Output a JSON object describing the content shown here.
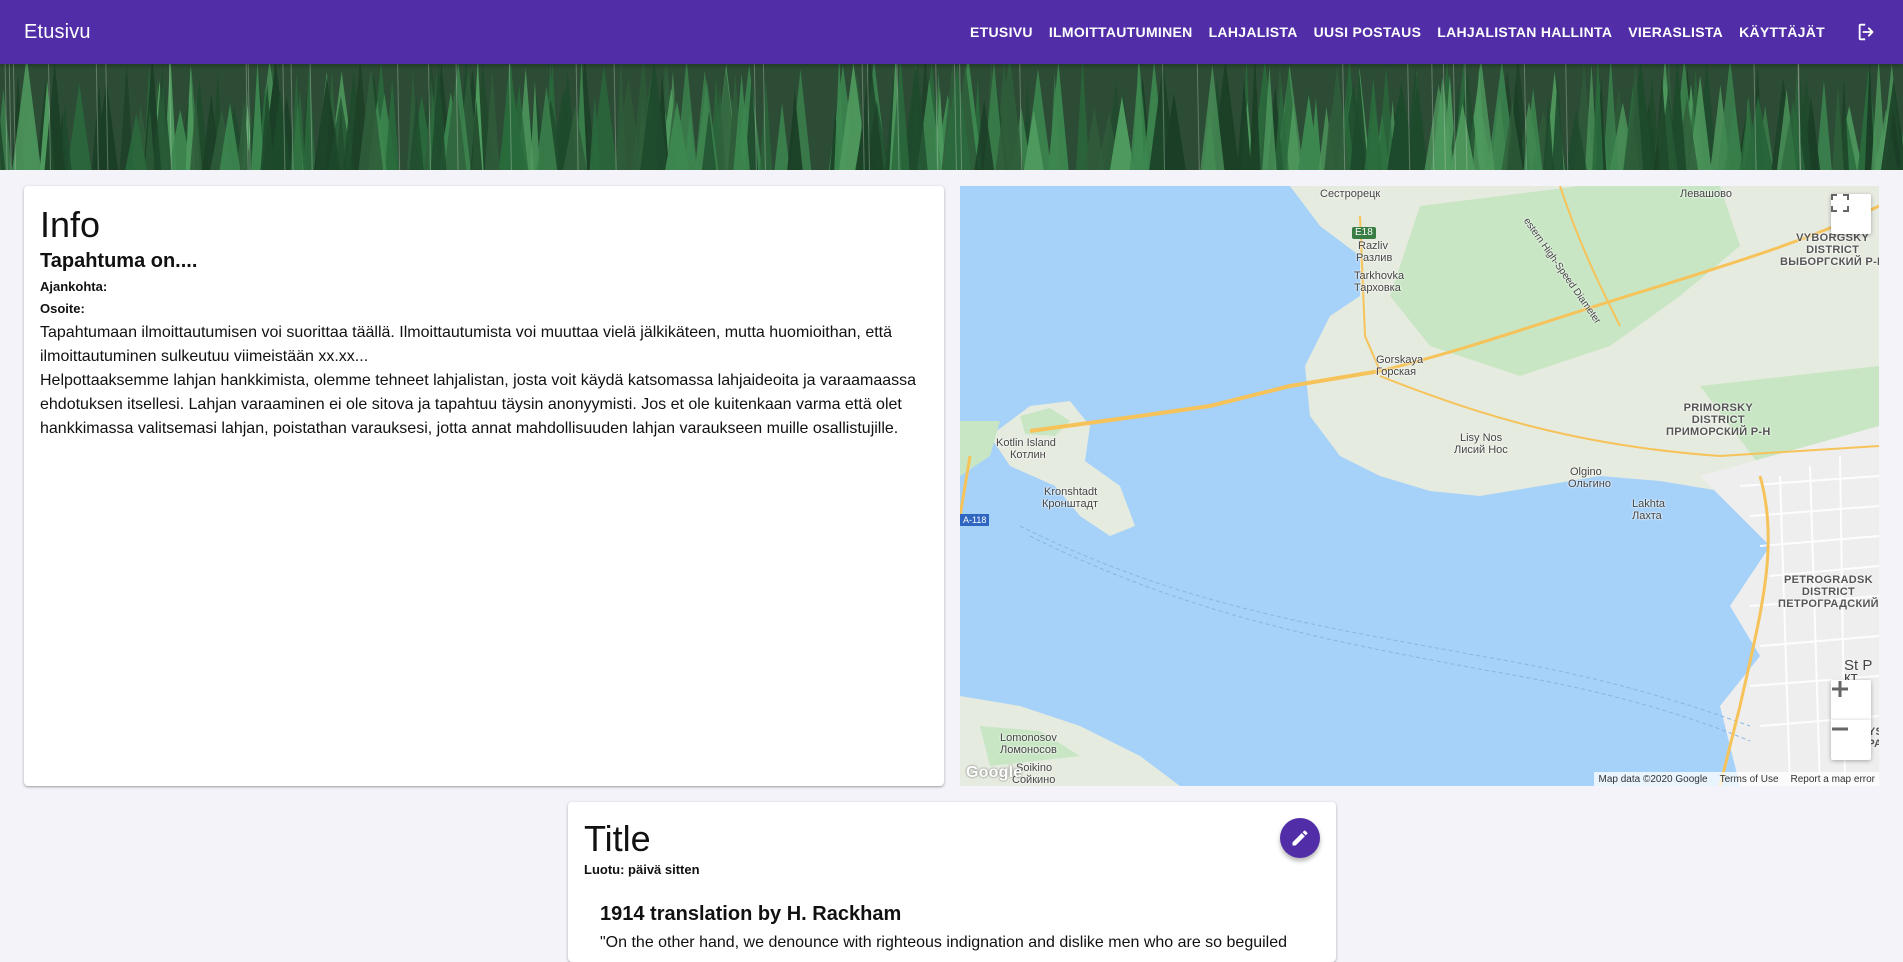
{
  "appbar": {
    "brand": "Etusivu",
    "nav": [
      {
        "label": "ETUSIVU"
      },
      {
        "label": "ILMOITTAUTUMINEN"
      },
      {
        "label": "LAHJALISTA"
      },
      {
        "label": "UUSI POSTAUS"
      },
      {
        "label": "LAHJALISTAN HALLINTA"
      },
      {
        "label": "VIERASLISTA"
      },
      {
        "label": "KÄYTTÄJÄT"
      }
    ],
    "logout_icon": "logout-icon"
  },
  "info": {
    "title": "Info",
    "subtitle": "Tapahtuma on....",
    "time_label": "Ajankohta:",
    "address_label": "Osoite:",
    "para1": "Tapahtumaan ilmoittautumisen voi suorittaa täällä. Ilmoittautumista voi muuttaa vielä jälkikäteen, mutta huomioithan, että ilmoittautuminen sulkeutuu viimeistään xx.xx...",
    "para2": "Helpottaaksemme lahjan hankkimista, olemme tehneet lahjalistan, josta voit käydä katsomassa lahjaideoita ja varaamaassa ehdotuksen itsellesi. Lahjan varaaminen ei ole sitova ja tapahtuu täysin anonyymisti. Jos et ole kuitenkaan varma että olet hankkimassa valitsemasi lahjan, poistathan varauksesi, jotta annat mahdollisuuden lahjan varaukseen muille osallistujille."
  },
  "map": {
    "labels": {
      "sestroretsk": "Сестрорецк",
      "levashovo": "Левашово",
      "e18": "E18",
      "razliv_en": "Razliv",
      "razliv_ru": "Разлив",
      "tarkhovka_en": "Tarkhovka",
      "tarkhovka_ru": "Тарховка",
      "gorskaya_en": "Gorskaya",
      "gorskaya_ru": "Горская",
      "lisy_en": "Lisy Nos",
      "lisy_ru": "Лисий Нос",
      "olgino_en": "Olgino",
      "olgino_ru": "Ольгино",
      "lakhta_en": "Lakhta",
      "lakhta_ru": "Лахта",
      "kotlin_en": "Kotlin Island",
      "kotlin_ru": "Котлин",
      "kronshtadt_en": "Kronshtadt",
      "kronshtadt_ru": "Кронштадт",
      "a118": "A-118",
      "lomonosov_en": "Lomonosov",
      "lomonosov_ru": "Ломоносов",
      "sosnovy": "Soikino",
      "sosnovy_ru": "Сойкино",
      "vyborgsky": "VYBORGSKY\nDISTRICT\nВЫБОРГСКИЙ Р-Н",
      "primorsky": "PRIMORSKY\nDISTRICT\nПРИМОРСКИЙ Р-Н",
      "petrogradsky": "PETROGRADSK\nDISTRICT\nПЕТРОГРАДСКИЙ",
      "stp": "St P\nкт",
      "admiral": "ADMI  YS\nАДМИРА",
      "highway": "estern High-Speed Diameter"
    },
    "fullscreen_icon": "fullscreen-icon",
    "zoom_in_icon": "plus-icon",
    "zoom_out_icon": "minus-icon",
    "google_logo": "Google",
    "footer": {
      "data": "Map data ©2020 Google",
      "terms": "Terms of Use",
      "report": "Report a map error"
    }
  },
  "post": {
    "title": "Title",
    "meta": "Luotu: päivä sitten",
    "heading": "1914 translation by H. Rackham",
    "text": "\"On the other hand, we denounce with righteous indignation and dislike men who are so beguiled",
    "edit_icon": "pencil-icon"
  },
  "colors": {
    "primary": "#512da8",
    "water": "#a6d1f8",
    "land": "#e6ebe0",
    "forest": "#c8e6c4"
  }
}
